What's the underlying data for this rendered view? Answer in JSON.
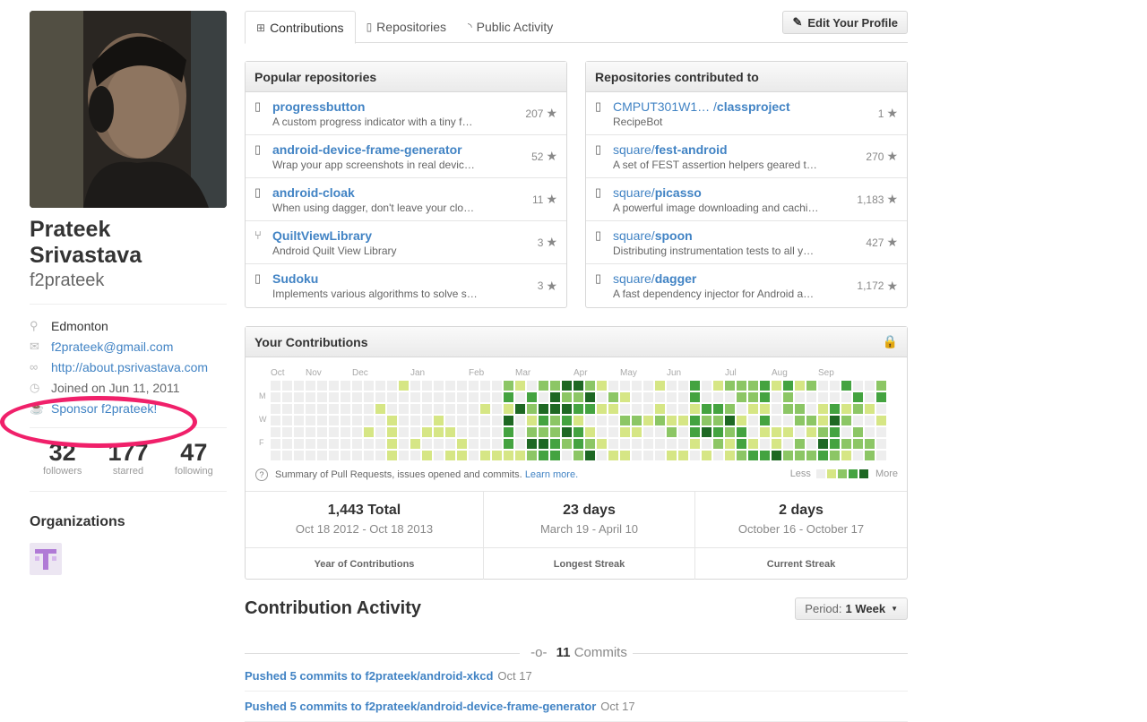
{
  "profile": {
    "full_name": "Prateek Srivastava",
    "username": "f2prateek",
    "location": "Edmonton",
    "email": "f2prateek@gmail.com",
    "website": "http://about.psrivastava.com",
    "joined": "Joined on Jun 11, 2011",
    "sponsor": "Sponsor f2prateek!",
    "stats": [
      {
        "num": "32",
        "label": "followers"
      },
      {
        "num": "177",
        "label": "starred"
      },
      {
        "num": "47",
        "label": "following"
      }
    ],
    "orgs_title": "Organizations"
  },
  "tabs": [
    {
      "label": "Contributions",
      "icon": "plus-square-icon"
    },
    {
      "label": "Repositories",
      "icon": "book-icon"
    },
    {
      "label": "Public Activity",
      "icon": "rss-icon"
    }
  ],
  "edit_profile": "Edit Your Profile",
  "popular": {
    "title": "Popular repositories",
    "repos": [
      {
        "name": "progressbutton",
        "desc": "A custom progress indicator with a tiny footprint",
        "stars": "207"
      },
      {
        "name": "android-device-frame-generator",
        "desc": "Wrap your app screenshots in real device art",
        "stars": "52"
      },
      {
        "name": "android-cloak",
        "desc": "When using dagger, don't leave your cloak behind",
        "stars": "11"
      },
      {
        "name": "QuiltViewLibrary",
        "desc": "Android Quilt View Library",
        "stars": "3"
      },
      {
        "name": "Sudoku",
        "desc": "Implements various algorithms to solve sudoku",
        "stars": "3"
      }
    ]
  },
  "contributed": {
    "title": "Repositories contributed to",
    "repos": [
      {
        "owner": "CMPUT301W1… /",
        "name": "classproject",
        "desc": "RecipeBot",
        "stars": "1"
      },
      {
        "owner": "square/",
        "name": "fest-android",
        "desc": "A set of FEST assertion helpers geared toward testing Android",
        "stars": "270"
      },
      {
        "owner": "square/",
        "name": "picasso",
        "desc": "A powerful image downloading and caching library for Android",
        "stars": "1,183"
      },
      {
        "owner": "square/",
        "name": "spoon",
        "desc": "Distributing instrumentation tests to all your Androids",
        "stars": "427"
      },
      {
        "owner": "square/",
        "name": "dagger",
        "desc": "A fast dependency injector for Android and Java",
        "stars": "1,172"
      }
    ]
  },
  "contributions": {
    "title": "Your Contributions",
    "months": [
      "Oct",
      "Nov",
      "Dec",
      "Jan",
      "Feb",
      "Mar",
      "Apr",
      "May",
      "Jun",
      "Jul",
      "Aug",
      "Sep"
    ],
    "day_labels": [
      "M",
      "W",
      "F"
    ],
    "summary": "Summary of Pull Requests, issues opened and commits.",
    "learn_more": "Learn more.",
    "legend_less": "Less",
    "legend_more": "More",
    "colors": [
      "#eeeeee",
      "#d6e685",
      "#8cc665",
      "#44a340",
      "#1e6823"
    ],
    "streaks": [
      {
        "big": "1,443 Total",
        "range": "Oct 18 2012 - Oct 18 2013",
        "caption": "Year of Contributions"
      },
      {
        "big": "23 days",
        "range": "March 19 - April 10",
        "caption": "Longest Streak"
      },
      {
        "big": "2 days",
        "range": "October 16 - October 17",
        "caption": "Current Streak"
      }
    ]
  },
  "activity": {
    "title": "Contribution Activity",
    "period_label": "Period:",
    "period_value": "1 Week",
    "commits_count": "11",
    "commits_label": "Commits",
    "pushes": [
      {
        "text": "Pushed 5 commits to f2prateek/android-xkcd",
        "date": "Oct 17"
      },
      {
        "text": "Pushed 5 commits to f2prateek/android-device-frame-generator",
        "date": "Oct 17"
      }
    ]
  }
}
